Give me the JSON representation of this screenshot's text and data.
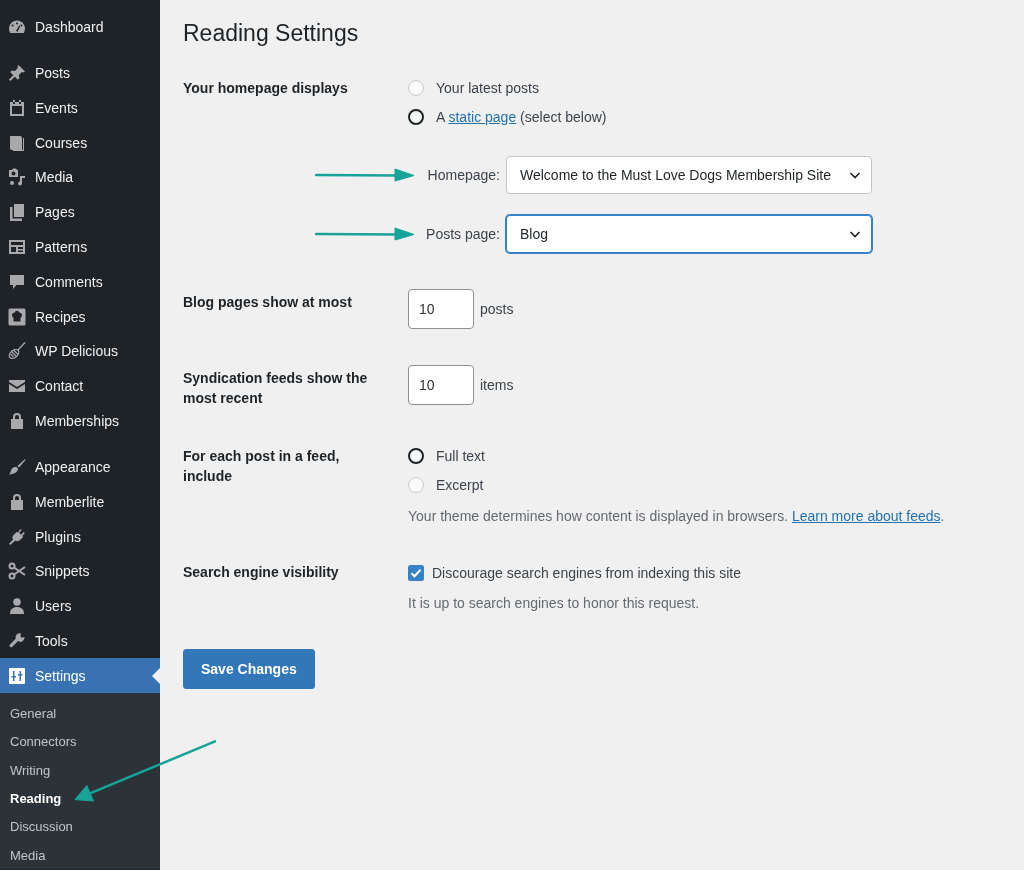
{
  "sidebar": {
    "groups": [
      {
        "items": [
          {
            "label": "Dashboard",
            "selected": false
          }
        ]
      },
      {
        "items": [
          {
            "label": "Posts",
            "selected": false
          },
          {
            "label": "Events",
            "selected": false
          },
          {
            "label": "Courses",
            "selected": false
          },
          {
            "label": "Media",
            "selected": false
          },
          {
            "label": "Pages",
            "selected": false
          },
          {
            "label": "Patterns",
            "selected": false
          },
          {
            "label": "Comments",
            "selected": false
          },
          {
            "label": "Recipes",
            "selected": false
          },
          {
            "label": "WP Delicious",
            "selected": false
          },
          {
            "label": "Contact",
            "selected": false
          },
          {
            "label": "Memberships",
            "selected": false
          }
        ]
      },
      {
        "items": [
          {
            "label": "Appearance",
            "selected": false
          },
          {
            "label": "Memberlite",
            "selected": false
          },
          {
            "label": "Plugins",
            "selected": false
          },
          {
            "label": "Snippets",
            "selected": false
          },
          {
            "label": "Users",
            "selected": false
          },
          {
            "label": "Tools",
            "selected": false
          },
          {
            "label": "Settings",
            "selected": true,
            "submenu": [
              {
                "label": "General",
                "selected": false,
                "arrow": false
              },
              {
                "label": "Connectors",
                "selected": false,
                "arrow": false
              },
              {
                "label": "Writing",
                "selected": false,
                "arrow": false
              },
              {
                "label": "Reading",
                "selected": true,
                "arrow": true
              },
              {
                "label": "Discussion",
                "selected": false,
                "arrow": false
              },
              {
                "label": "Media",
                "selected": false,
                "arrow": false
              }
            ]
          }
        ]
      }
    ]
  },
  "page": {
    "title": "Reading Settings",
    "settings": [
      {
        "kind": "radio_group",
        "label": "Your homepage displays",
        "options": [
          {
            "text": "Your latest posts",
            "selected": false
          },
          {
            "text": "A",
            "link": "static page",
            "text_after": "(select below)",
            "selected": true
          }
        ],
        "selects": [
          {
            "label": "Homepage:",
            "value": "Welcome to the Must Love Dogs Membership Site",
            "focused": false,
            "arrow": true
          },
          {
            "label": "Posts page:",
            "value": "Blog",
            "focused": true,
            "arrow": true
          }
        ]
      },
      {
        "kind": "number",
        "label": "Blog pages show at most",
        "value": "10",
        "unit": "posts"
      },
      {
        "kind": "number",
        "label": "Syndication feeds show the most recent",
        "value": "10",
        "unit": "items"
      },
      {
        "kind": "radio_group",
        "label": "For each post in a feed, include",
        "options": [
          {
            "text": "Full text",
            "selected": true
          },
          {
            "text": "Excerpt",
            "selected": false
          }
        ],
        "description": "Your theme determines how content is displayed in browsers.",
        "description_link": "Learn more about feeds",
        "description_after": "."
      },
      {
        "kind": "checkbox",
        "label": "Search engine visibility",
        "text": "Discourage search engines from indexing this site",
        "checked": true,
        "description": "It is up to search engines to honor this request."
      }
    ],
    "save_button": "Save Changes"
  }
}
